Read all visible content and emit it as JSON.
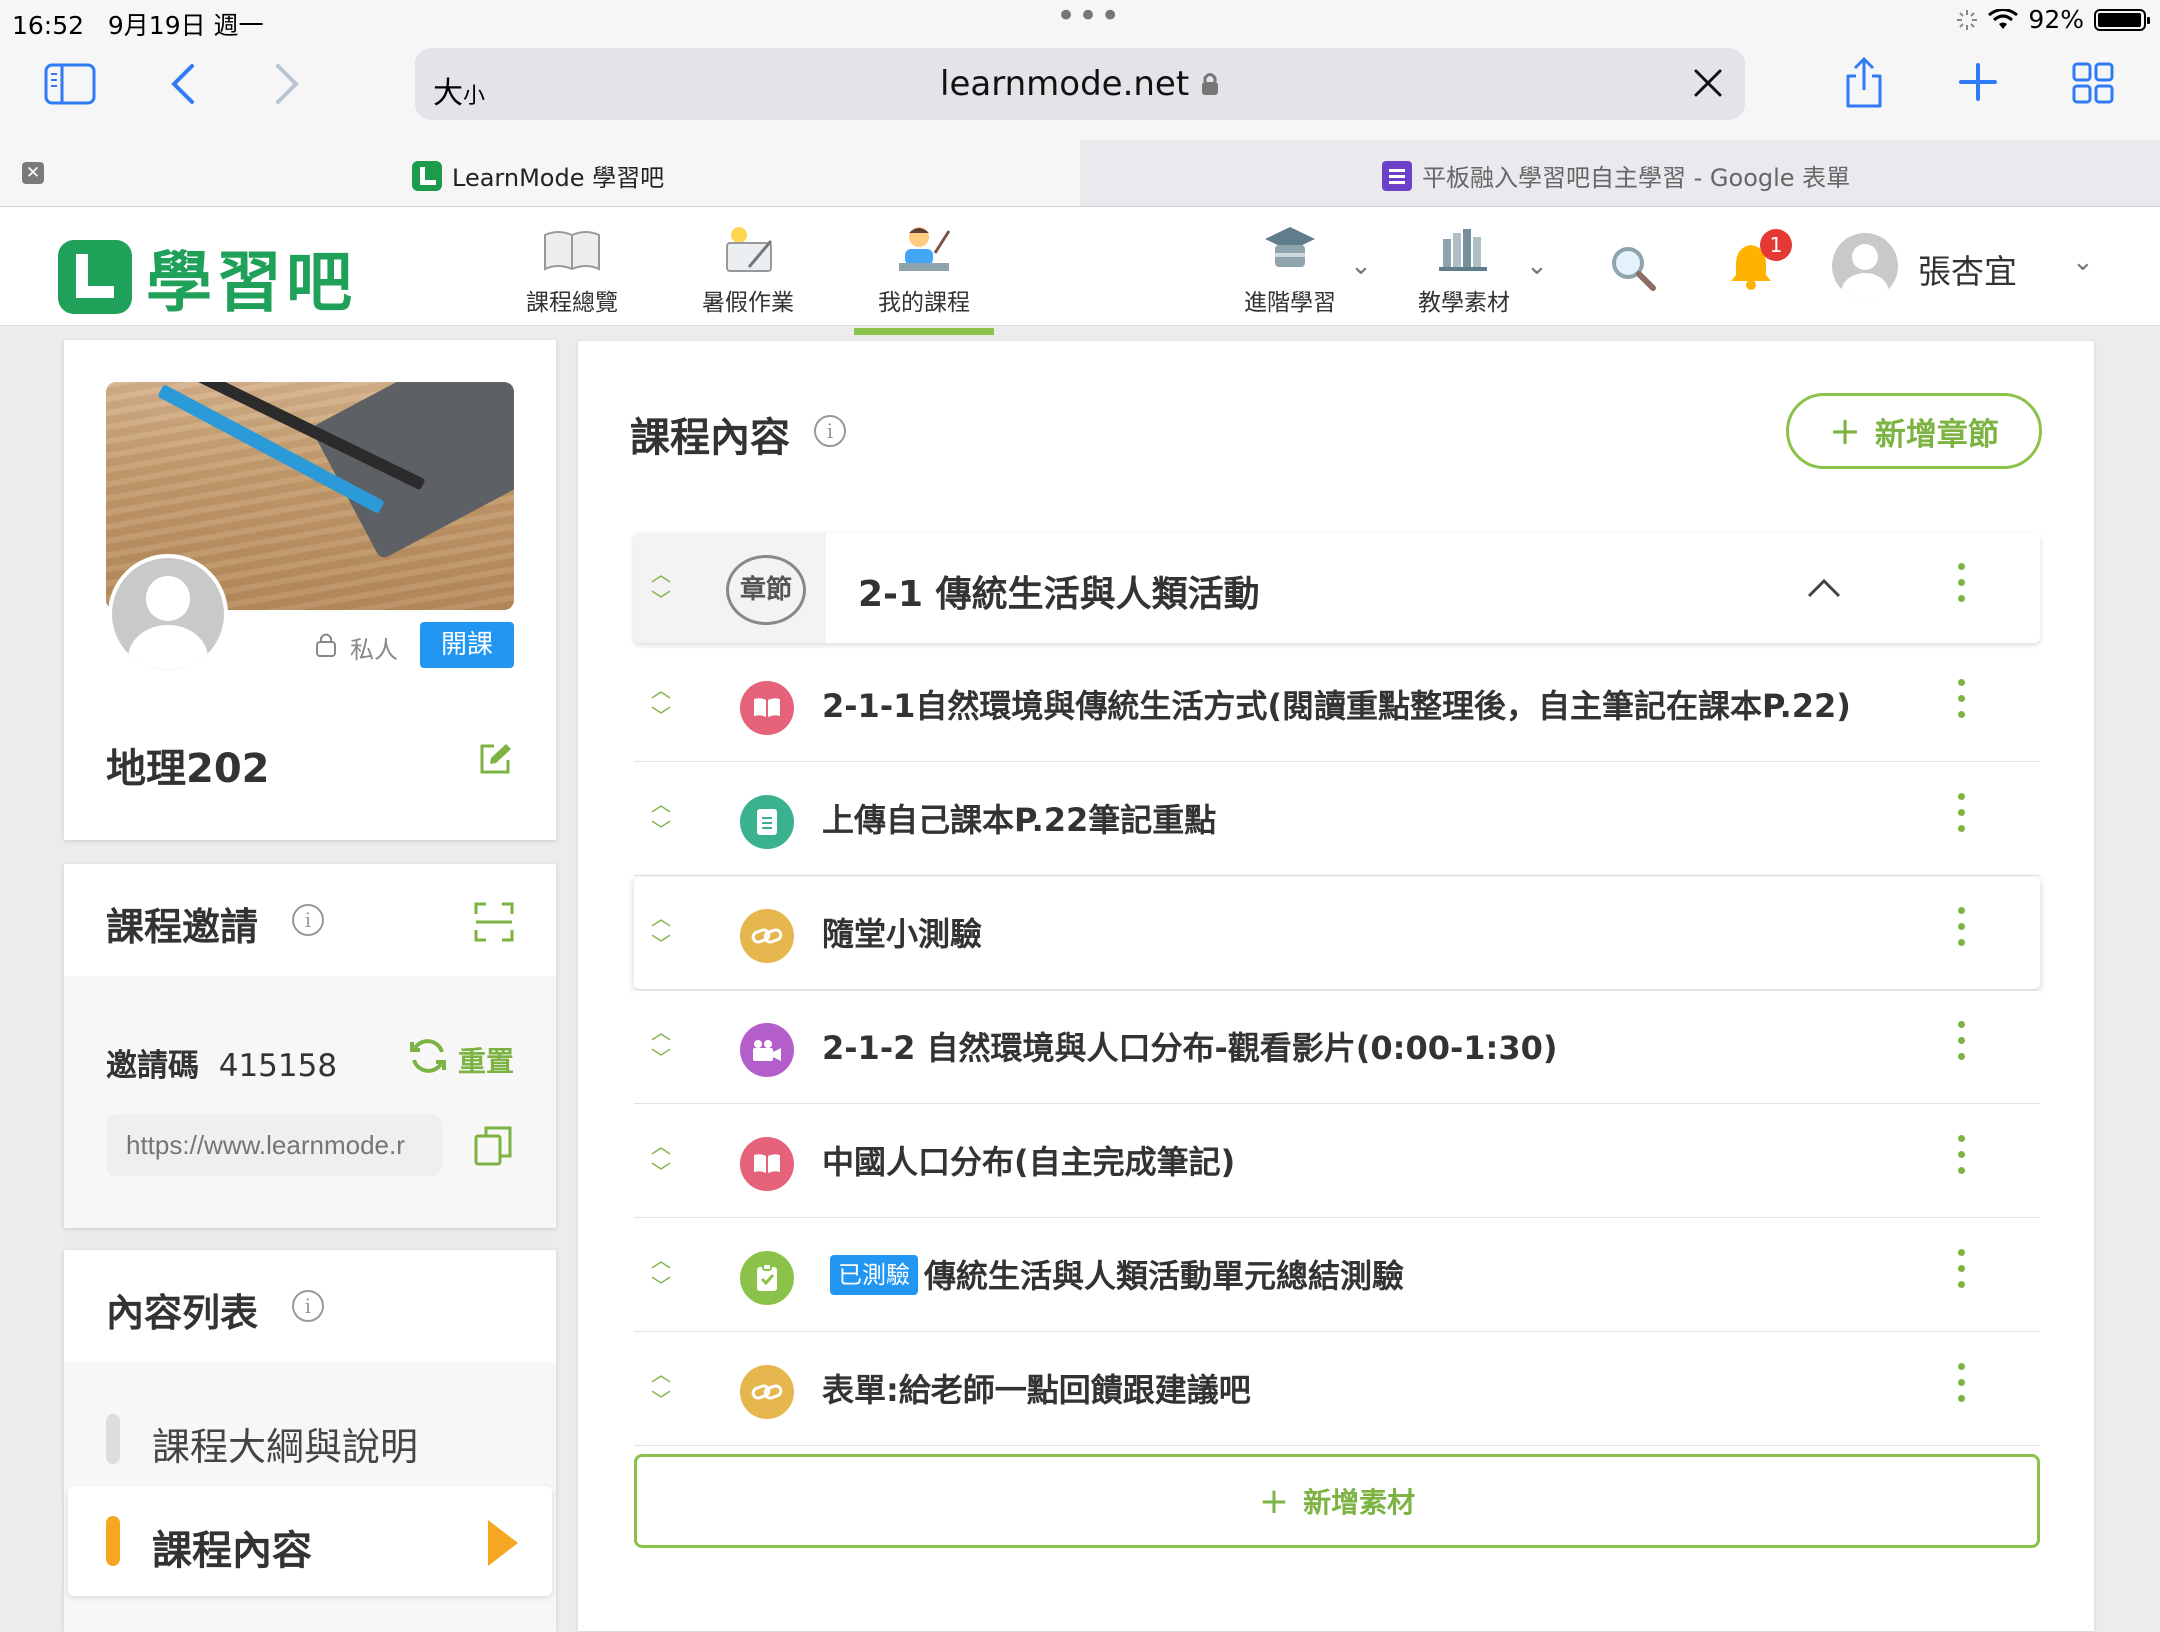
{
  "status_bar": {
    "time": "16:52",
    "date": "9月19日 週一",
    "battery": "92%"
  },
  "browser": {
    "text_size_label": "大",
    "text_size_small": "小",
    "url": "learnmode.net",
    "tabs": [
      {
        "title": "LearnMode 學習吧",
        "active": true
      },
      {
        "title": "平板融入學習吧自主學習 - Google 表單",
        "active": false
      }
    ]
  },
  "site": {
    "logo_text": "學習吧",
    "nav": [
      {
        "label": "課程總覽"
      },
      {
        "label": "暑假作業"
      },
      {
        "label": "我的課程",
        "active": true
      },
      {
        "label": "進階學習"
      },
      {
        "label": "教學素材"
      }
    ],
    "notification_count": "1",
    "user_name": "張杏宜"
  },
  "course": {
    "privacy_label": "私人",
    "open_button": "開課",
    "name": "地理202"
  },
  "invite": {
    "title": "課程邀請",
    "code_label": "邀請碼",
    "code": "415158",
    "reset_label": "重置",
    "link_placeholder": "https://www.learnmode.r"
  },
  "content_list": {
    "title": "內容列表",
    "items": [
      {
        "label": "課程大綱與說明",
        "active": false
      },
      {
        "label": "課程內容",
        "active": true
      }
    ]
  },
  "main": {
    "title": "課程內容",
    "add_chapter_label": "新增章節",
    "chapter": {
      "badge": "章節",
      "title": "2-1 傳統生活與人類活動"
    },
    "items": [
      {
        "type": "reading",
        "title": "2-1-1自然環境與傳統生活方式(閱讀重點整理後，自主筆記在課本P.22)"
      },
      {
        "type": "upload",
        "title": "上傳自己課本P.22筆記重點"
      },
      {
        "type": "link",
        "title": "隨堂小測驗"
      },
      {
        "type": "video",
        "title": "2-1-2 自然環境與人口分布-觀看影片(0:00-1:30)"
      },
      {
        "type": "reading",
        "title": "中國人口分布(自主完成筆記)"
      },
      {
        "type": "quiz",
        "tag": "已測驗",
        "title": "傳統生活與人類活動單元總結測驗"
      },
      {
        "type": "link",
        "title": "表單:給老師一點回饋跟建議吧"
      }
    ],
    "add_material_label": "新增素材"
  },
  "colors": {
    "accent_green": "#8bc34a",
    "brand_green": "#1fa15a",
    "orange": "#f5a623",
    "blue": "#2196f3"
  }
}
